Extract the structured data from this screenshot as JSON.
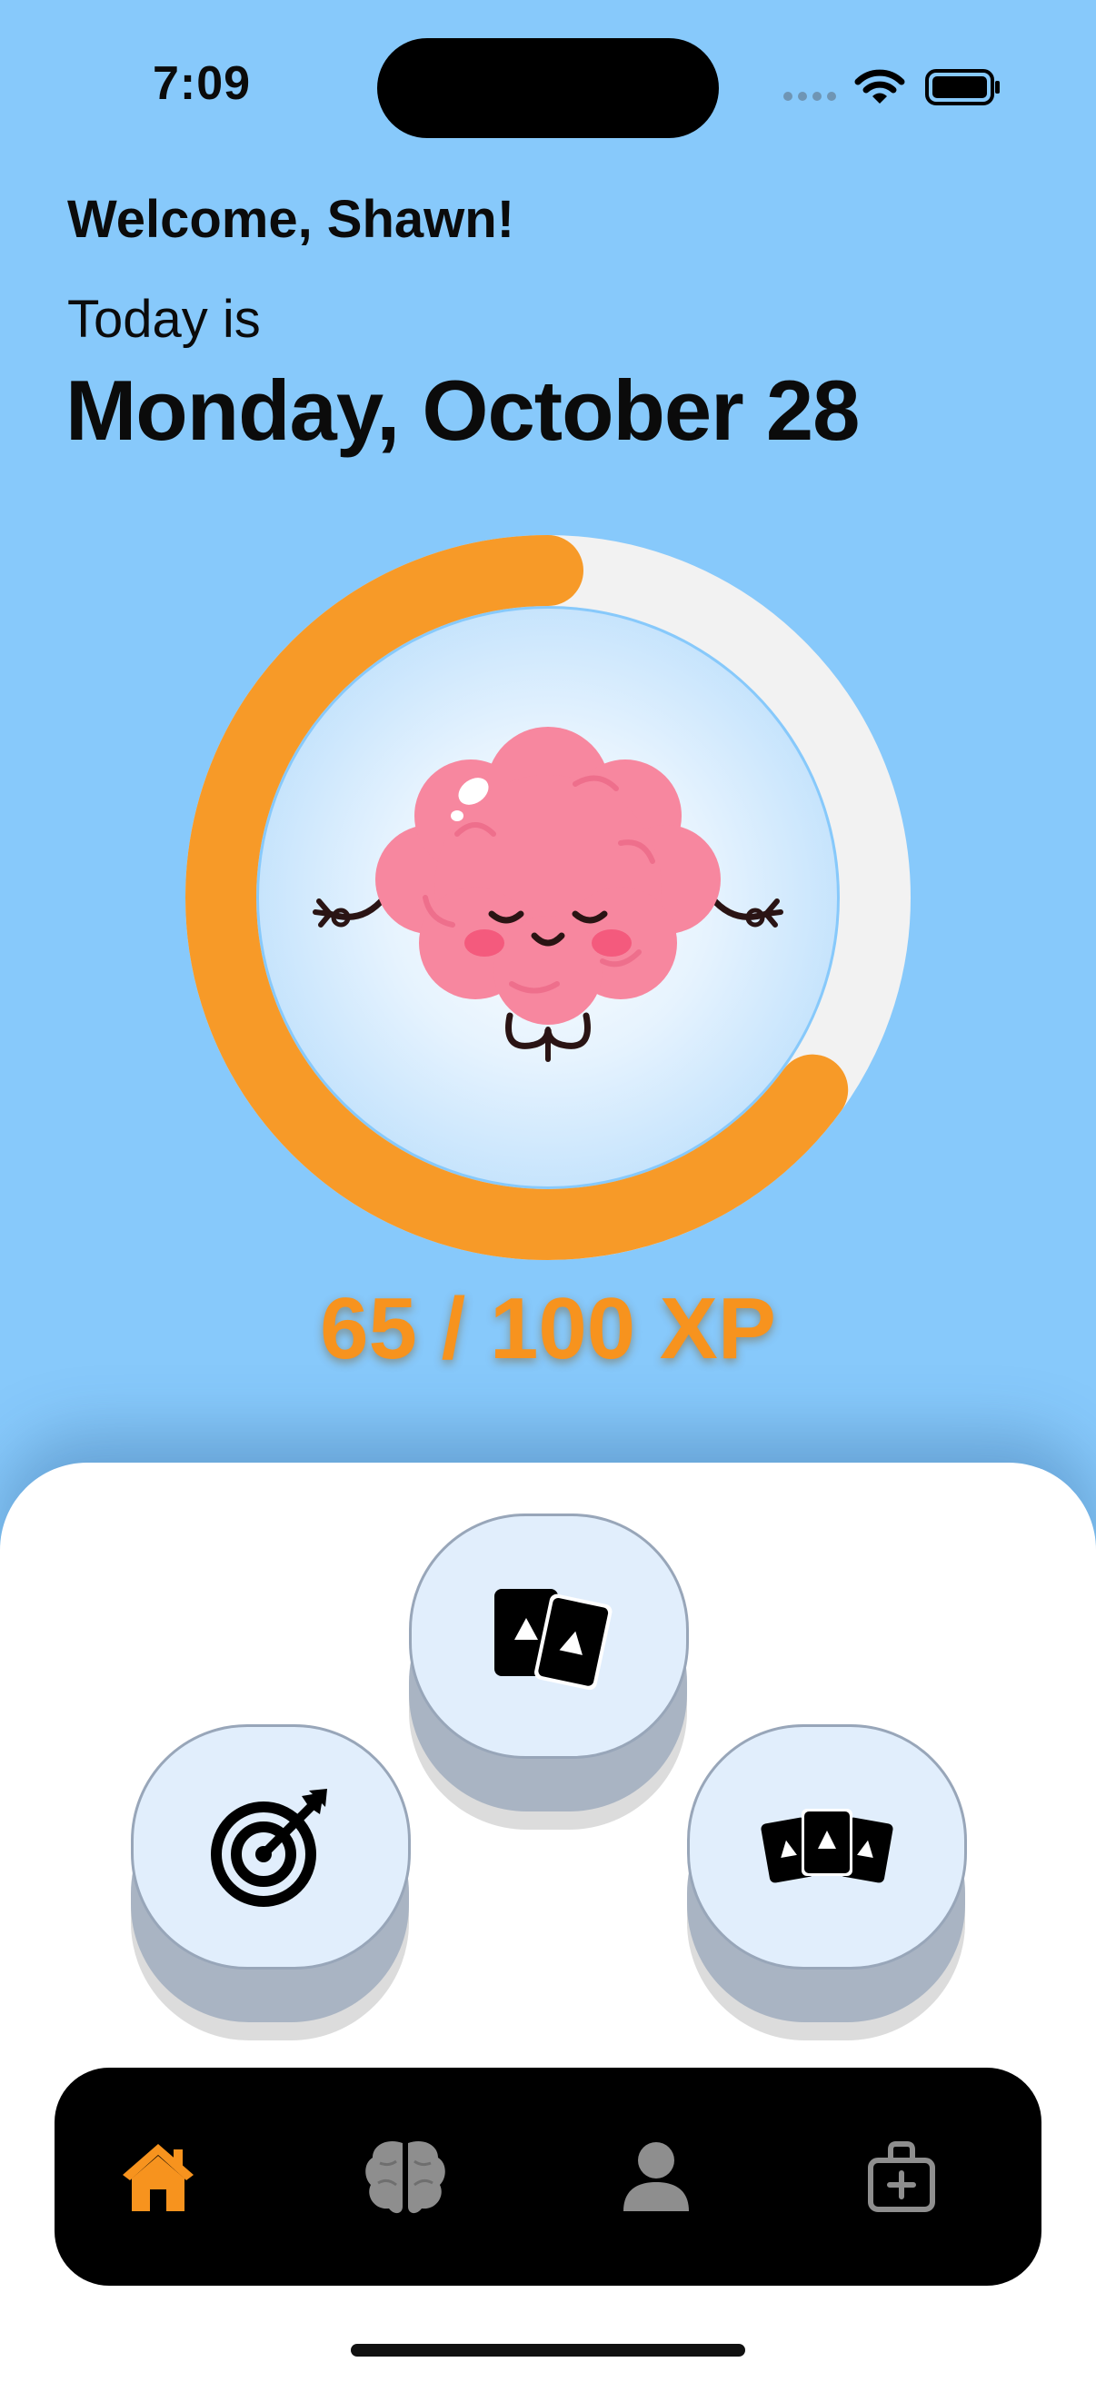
{
  "status": {
    "time": "7:09"
  },
  "header": {
    "welcome": "Welcome, Shawn!",
    "today_label": "Today is",
    "date": "Monday, October 28"
  },
  "progress": {
    "current_xp": 65,
    "max_xp": 100,
    "fraction": 0.65,
    "label": "65 / 100 XP",
    "ring_color": "#f79a28",
    "track_color": "#f2f2f2",
    "mascot": "meditating-brain"
  },
  "actions": [
    {
      "name": "flashcards-pair",
      "icon": "two-cards-icon"
    },
    {
      "name": "goals",
      "icon": "target-arrow-icon"
    },
    {
      "name": "flashcards-deck",
      "icon": "three-cards-icon"
    }
  ],
  "tab_bar": {
    "tabs": [
      {
        "name": "home",
        "icon": "house-icon",
        "active": true
      },
      {
        "name": "brain",
        "icon": "brain-icon",
        "active": false
      },
      {
        "name": "profile",
        "icon": "person-icon",
        "active": false
      },
      {
        "name": "kit",
        "icon": "briefcase-plus-icon",
        "active": false
      }
    ],
    "active_color": "#f7931e",
    "inactive_color": "#8e8e8e"
  },
  "colors": {
    "background": "#87c9fb",
    "xp_text": "#f7931e",
    "button_face": "#e1eefc"
  }
}
